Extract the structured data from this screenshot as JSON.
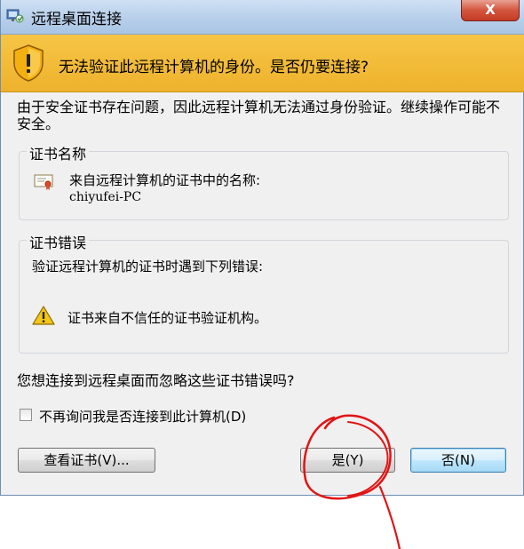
{
  "window": {
    "title": "远程桌面连接",
    "close_label": "X",
    "banner_message": "无法验证此远程计算机的身份。是否仍要连接?",
    "intro": "由于安全证书存在问题，因此远程计算机无法通过身份验证。继续操作可能不安全。"
  },
  "cert_name_group": {
    "title": "证书名称",
    "label": "来自远程计算机的证书中的名称:",
    "value": "chiyufei-PC"
  },
  "cert_error_group": {
    "title": "证书错误",
    "description": "验证远程计算机的证书时遇到下列错误:",
    "error": "证书来自不信任的证书验证机构。"
  },
  "question": "您想连接到远程桌面而忽略这些证书错误吗?",
  "checkbox": {
    "label": "不再询问我是否连接到此计算机(D)",
    "checked": false
  },
  "buttons": {
    "view_cert": "查看证书(V)...",
    "yes": "是(Y)",
    "no": "否(N)"
  },
  "colors": {
    "banner": "#f3bf3e",
    "annotation_circle": "#e01515",
    "default_button_border": "#3c7fb1"
  },
  "icons": [
    "remote-desktop-icon",
    "close-icon",
    "security-shield-warning-icon",
    "certificate-icon",
    "warning-icon"
  ]
}
